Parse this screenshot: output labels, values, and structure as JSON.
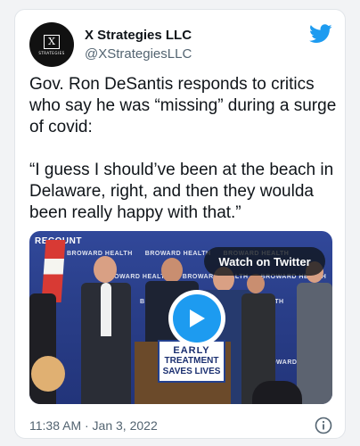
{
  "account": {
    "name": "X Strategies LLC",
    "handle": "@XStrategiesLLC",
    "avatar_letter": "X",
    "avatar_subtext": "STRATEGIES"
  },
  "tweet": {
    "text": "Gov. Ron DeSantis responds to critics who say he was “missing” during a surge of covid:\n\n“I guess I should’ve been at the beach in Delaware, right, and then they woulda been really happy with that.”",
    "timestamp": "11:38 AM · Jan 3, 2022"
  },
  "media": {
    "watch_label": "Watch on Twitter",
    "backdrop_top_label": "RECOUNT",
    "backdrop_text": "BROWARD HEALTH",
    "sign_line1": "EARLY",
    "sign_line2": "TREATMENT",
    "sign_line3": "SAVES LIVES"
  },
  "icons": {
    "brand": "twitter-bird-icon",
    "play": "play-icon",
    "info": "info-icon"
  },
  "colors": {
    "accent": "#1d9bf0",
    "text": "#0f1419",
    "secondary": "#536471"
  }
}
